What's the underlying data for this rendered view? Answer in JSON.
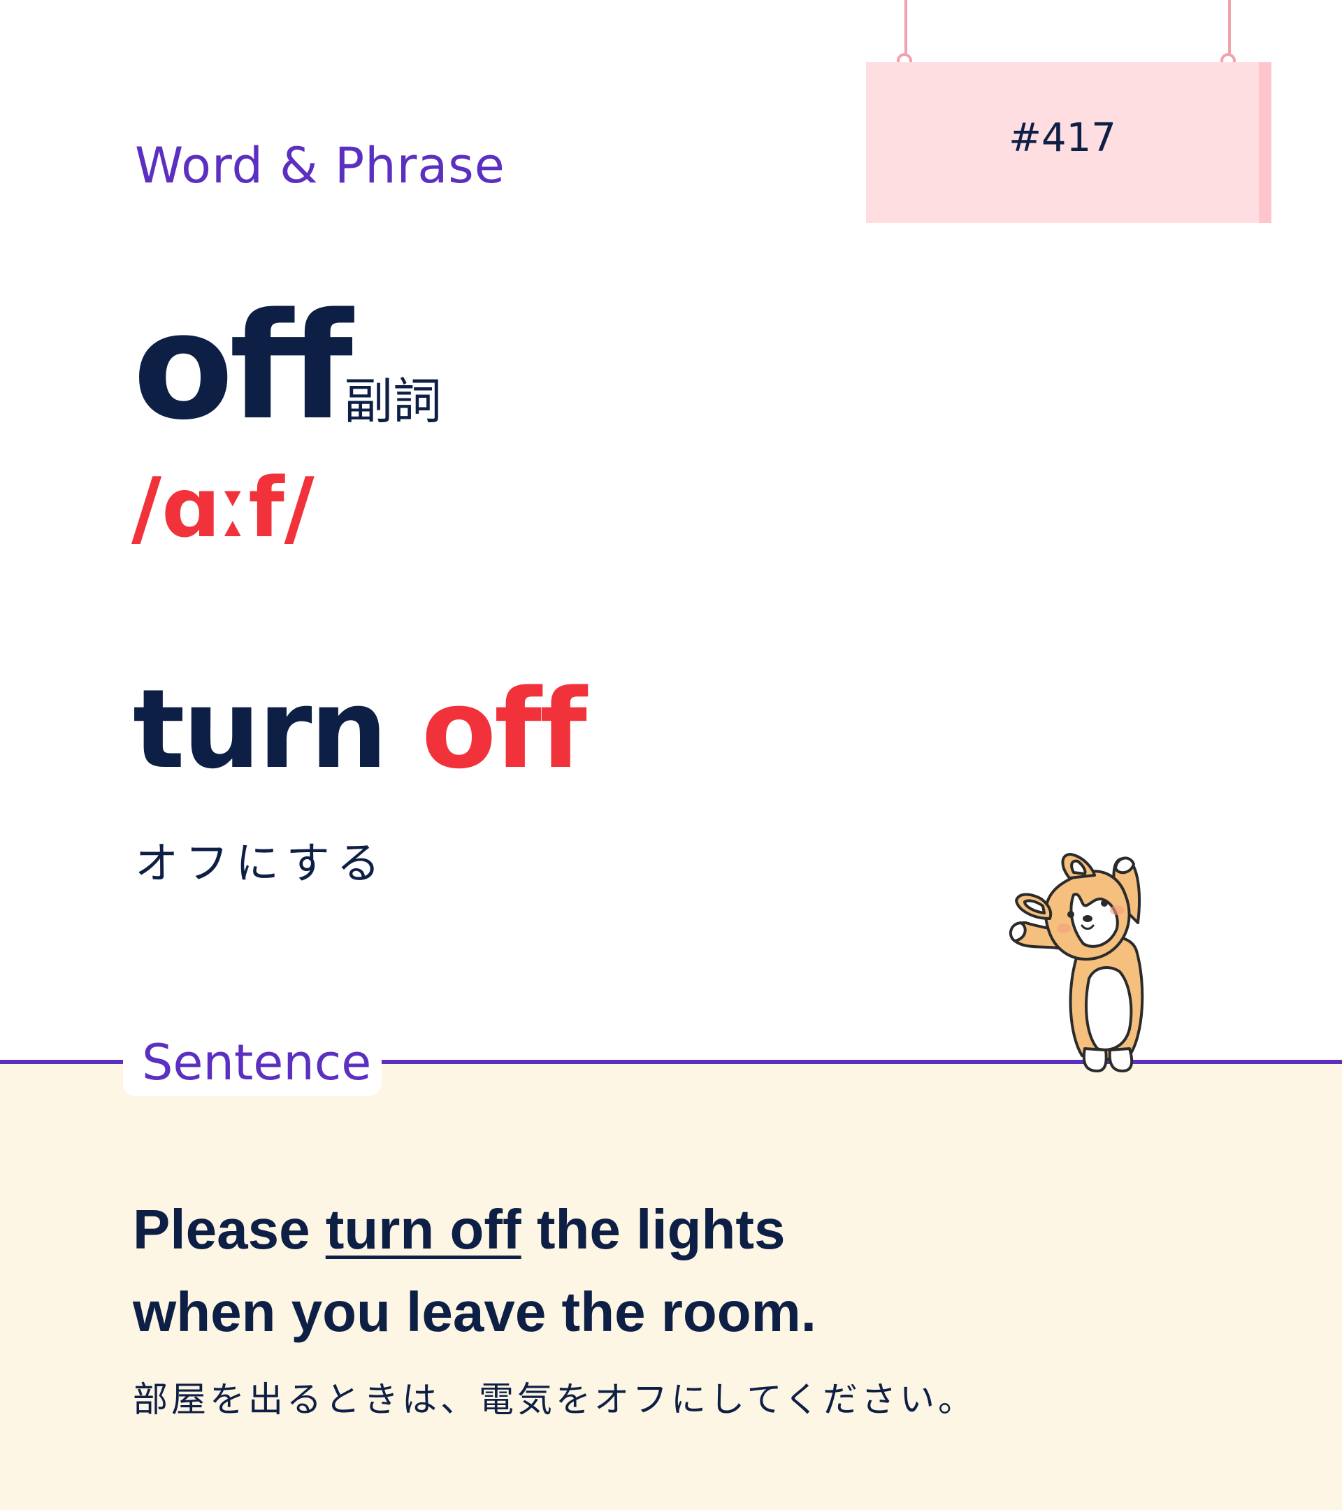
{
  "header": {
    "section_label": "Word & Phrase"
  },
  "sign": {
    "number": "#417"
  },
  "entry": {
    "word": "off",
    "part_of_speech": "副詞",
    "pronunciation": "/ɑːf/"
  },
  "phrase": {
    "main": "turn",
    "accent": "off",
    "meaning": "オフにする"
  },
  "sentence_section": {
    "label": "Sentence",
    "line1_before": "Please ",
    "line1_highlight": "turn off",
    "line1_after": " the lights",
    "line2": "when you leave the room.",
    "translation": "部屋を出るときは、電気をオフにしてください。"
  },
  "colors": {
    "navy": "#0e1f45",
    "red": "#f2323a",
    "purple": "#5b2fc0",
    "sign_pink": "#ffdee2",
    "cream": "#fdf6e4"
  },
  "illustration": {
    "icon": "corgi-stretching-icon"
  }
}
